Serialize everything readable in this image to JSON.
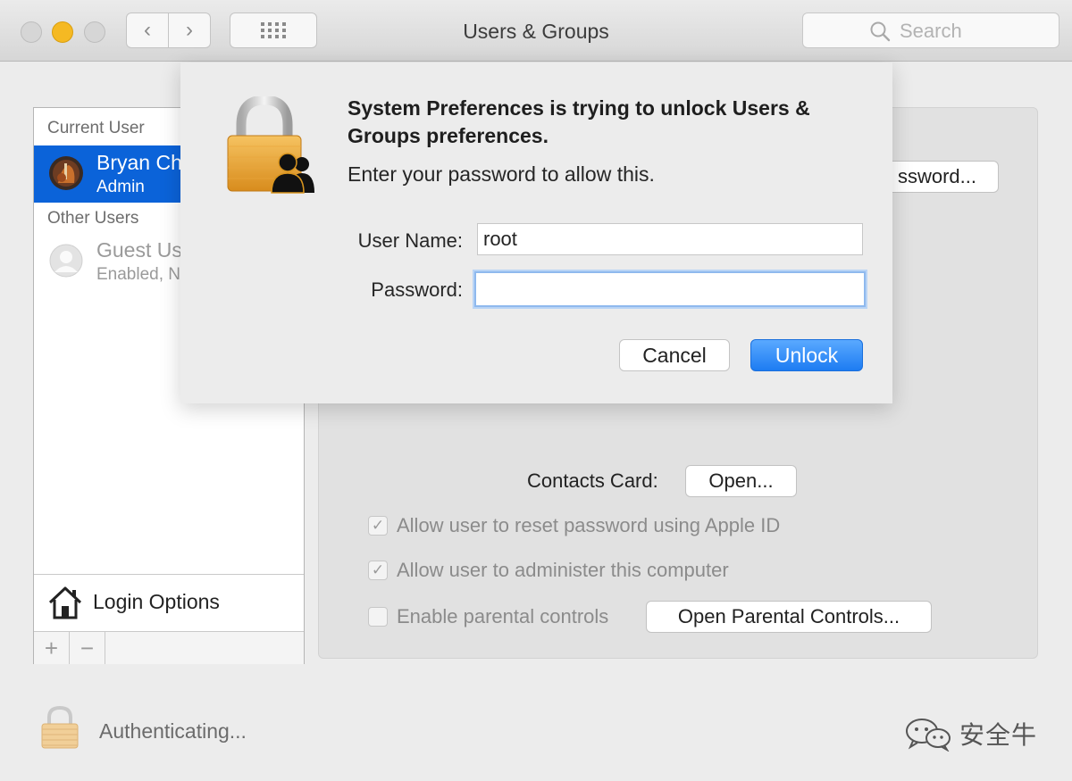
{
  "window": {
    "title": "Users & Groups"
  },
  "toolbar": {
    "back_glyph": "‹",
    "forward_glyph": "›",
    "search_placeholder": "Search"
  },
  "sidebar": {
    "current_user_header": "Current User",
    "current_user": {
      "name": "Bryan Ch",
      "role": "Admin"
    },
    "other_users_header": "Other Users",
    "guest_user": {
      "name": "Guest Us",
      "status": "Enabled, N"
    },
    "login_options_label": "Login Options",
    "add_glyph": "+",
    "remove_glyph": "−"
  },
  "panel": {
    "change_password_button": "ssword...",
    "contacts_card_label": "Contacts Card:",
    "contacts_open_button": "Open...",
    "checkboxes": [
      {
        "label": "Allow user to reset password using Apple ID",
        "checked": true
      },
      {
        "label": "Allow user to administer this computer",
        "checked": true
      },
      {
        "label": "Enable parental controls",
        "checked": false
      }
    ],
    "parental_controls_button": "Open Parental Controls..."
  },
  "dialog": {
    "title": "System Preferences is trying to unlock Users & Groups preferences.",
    "message": "Enter your password to allow this.",
    "username_label": "User Name:",
    "username_value": "root",
    "password_label": "Password:",
    "password_value": "",
    "cancel_button": "Cancel",
    "unlock_button": "Unlock"
  },
  "footer": {
    "status_text": "Authenticating...",
    "watermark_text": "安全牛"
  },
  "colors": {
    "selection_blue": "#0b63d9",
    "unlock_button_blue": "#1d7cf2",
    "minimize_yellow": "#f5b923",
    "lock_gold": "#e8a93a"
  },
  "icons": [
    "search-icon",
    "grid-icon",
    "lock-icon",
    "user-silhouettes-icon",
    "home-icon",
    "guest-avatar-icon",
    "wechat-icon"
  ]
}
